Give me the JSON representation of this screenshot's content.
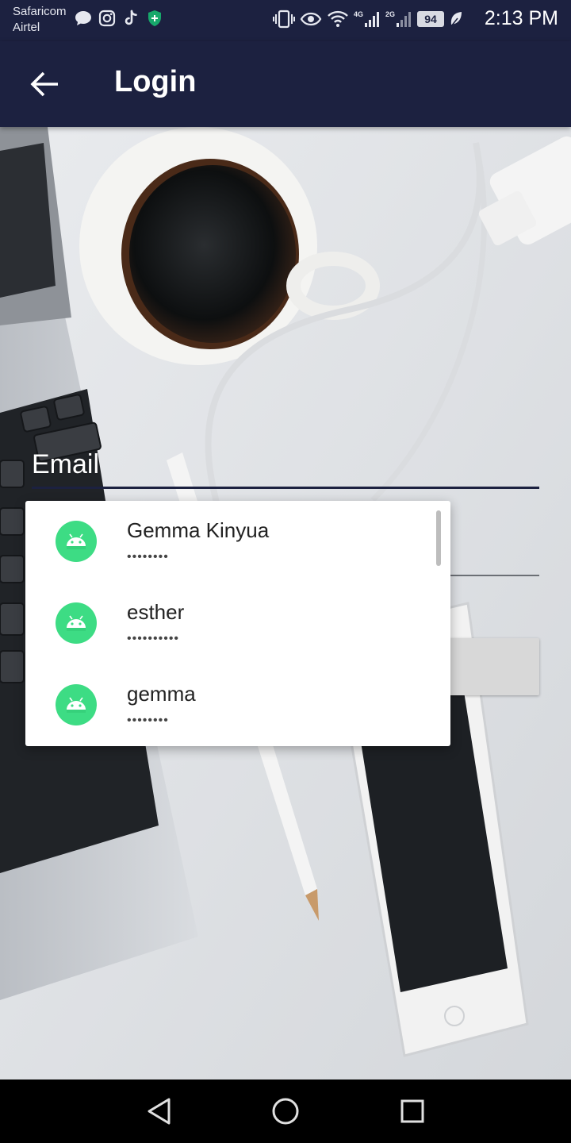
{
  "status_bar": {
    "carrier_1": "Safaricom",
    "carrier_2": "Airtel",
    "network_1": "4G",
    "network_2": "2G",
    "battery_level": "94",
    "time": "2:13 PM",
    "notification_icons": [
      "message-bubble-icon",
      "instagram-icon",
      "tiktok-icon",
      "shield-icon"
    ],
    "system_icons": [
      "vibrate-icon",
      "eye-comfort-icon",
      "wifi-icon",
      "signal-icon",
      "signal-icon",
      "battery-icon",
      "leaf-icon"
    ]
  },
  "app_bar": {
    "title": "Login",
    "back_icon": "arrow-left-icon",
    "color": "#1c2140"
  },
  "form": {
    "email_label": "Email",
    "email_value": "",
    "password_value": "",
    "login_label": "",
    "email_underline_color": "#1c2140"
  },
  "autofill": {
    "items": [
      {
        "name": "Gemma Kinyua",
        "masked_password": "••••••••",
        "icon": "android-icon"
      },
      {
        "name": "esther",
        "masked_password": "••••••••••",
        "icon": "android-icon"
      },
      {
        "name": "gemma",
        "masked_password": "••••••••",
        "icon": "android-icon"
      }
    ],
    "avatar_color": "#3ddc84"
  },
  "nav_bar": {
    "buttons": [
      "back-triangle-icon",
      "home-circle-icon",
      "recents-square-icon"
    ]
  }
}
